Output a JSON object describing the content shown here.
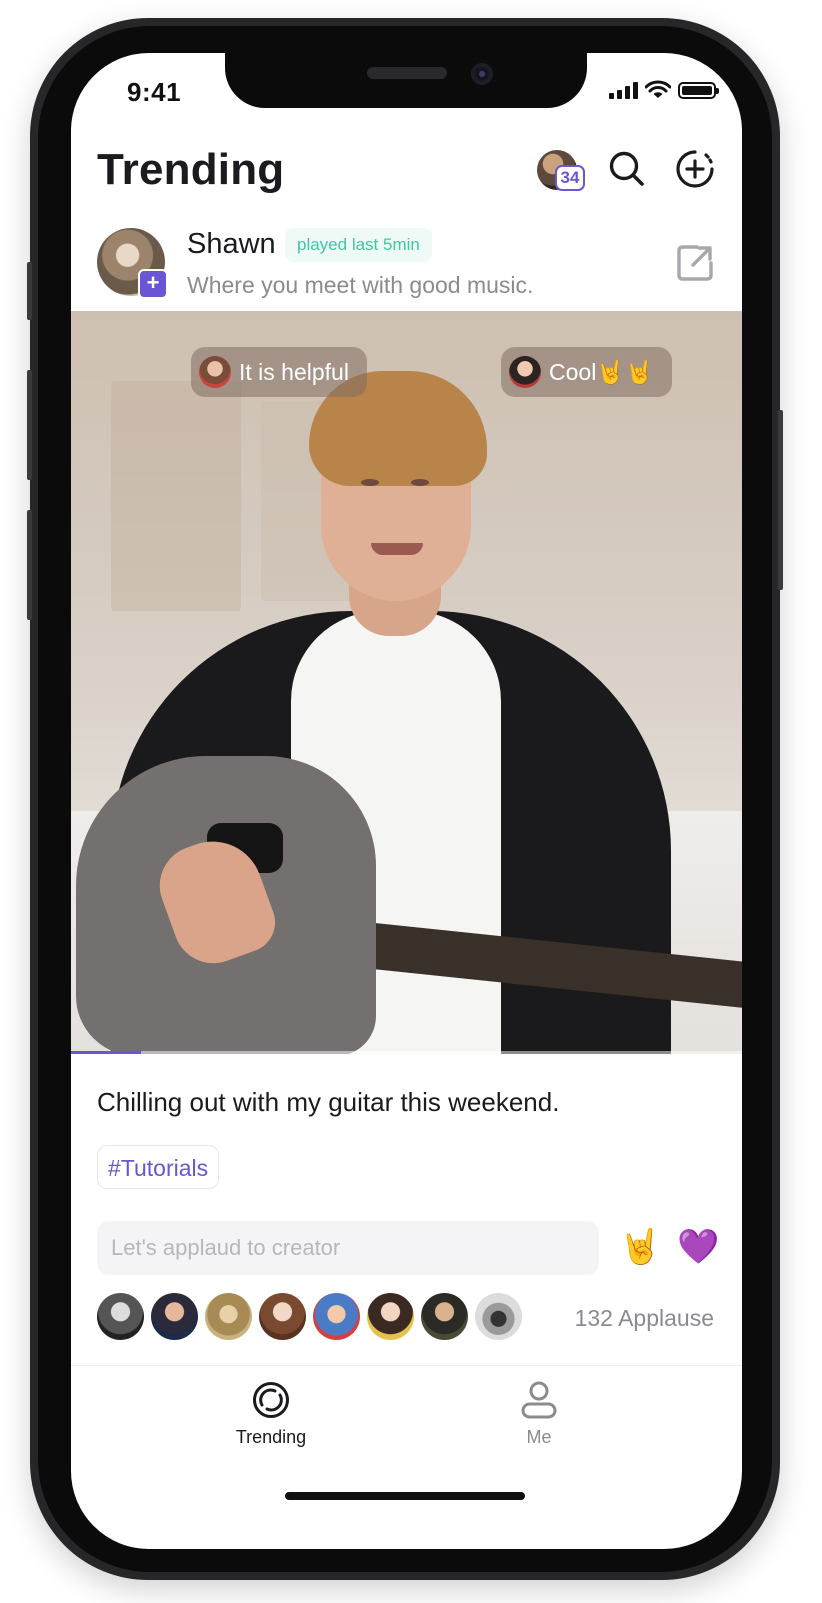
{
  "status_bar": {
    "time": "9:41"
  },
  "header": {
    "title": "Trending",
    "notification_count": "34"
  },
  "post": {
    "author": {
      "name": "Shawn",
      "activity_tag": "played last 5min",
      "bio": "Where you meet with good music."
    },
    "video": {
      "progress": 0.105
    },
    "bullet_comments": [
      {
        "text": "It is helpful"
      },
      {
        "text": "Cool🤘🤘"
      }
    ],
    "caption": "Chilling out with my guitar this weekend.",
    "hashtag": "#Tutorials",
    "applaud_input": {
      "placeholder": "Let's applaud to creator",
      "value": ""
    },
    "reactions": [
      {
        "icon": "rock-hand-icon",
        "glyph": "🤘"
      },
      {
        "icon": "purple-heart-icon",
        "glyph": "💜"
      }
    ],
    "applause_count": "132 Applause"
  },
  "tab_bar": {
    "tabs": [
      {
        "label": "Trending",
        "icon": "trending-icon",
        "active": true
      },
      {
        "label": "Me",
        "icon": "profile-icon",
        "active": false
      }
    ]
  },
  "colors": {
    "accent": "#6a55d3",
    "tag_green": "#3fc6a4",
    "text_primary": "#1b1b1f",
    "text_secondary": "#8a8a8f"
  }
}
